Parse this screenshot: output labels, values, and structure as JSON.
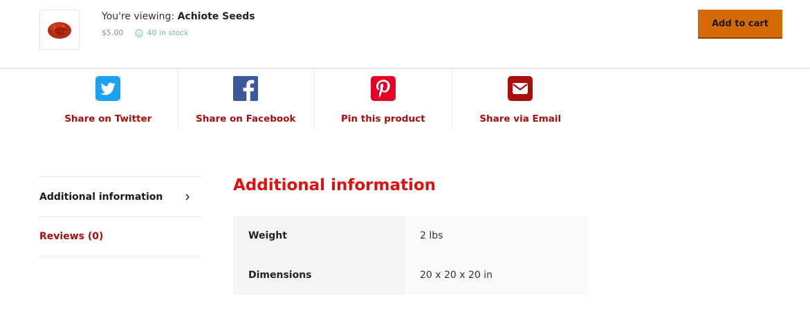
{
  "sticky_bar": {
    "viewing_prefix": "You're viewing:",
    "product_name": "Achiote Seeds",
    "price": "$5.00",
    "stock": "40 in stock",
    "add_to_cart_label": "Add to cart",
    "thumbnail_icon": "achiote-seeds-thumbnail"
  },
  "share": {
    "items": [
      {
        "label": "Share on Twitter",
        "icon": "twitter-icon",
        "color": "#1da1f2"
      },
      {
        "label": "Share on Facebook",
        "icon": "facebook-icon",
        "color": "#3b5998"
      },
      {
        "label": "Pin this product",
        "icon": "pinterest-icon",
        "color": "#e60023"
      },
      {
        "label": "Share via Email",
        "icon": "email-icon",
        "color": "#a90e0e"
      }
    ]
  },
  "tabs": [
    {
      "label": "Additional information",
      "active": true
    },
    {
      "label": "Reviews (0)",
      "active": false
    }
  ],
  "panel": {
    "title": "Additional information",
    "attributes": [
      {
        "name": "Weight",
        "value": "2 lbs"
      },
      {
        "name": "Dimensions",
        "value": "20 x 20 x 20 in"
      }
    ]
  },
  "colors": {
    "accent_red": "#a90e0e",
    "heading_red": "#e01010",
    "button_orange": "#d46a06",
    "stock_green": "#6dbd9e"
  }
}
